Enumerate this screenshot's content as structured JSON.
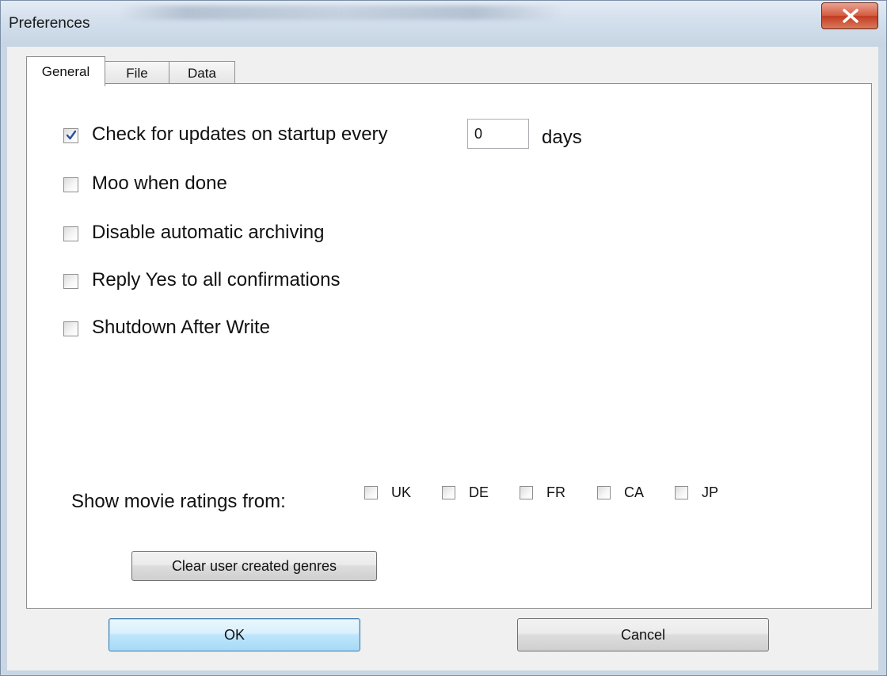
{
  "window": {
    "title": "Preferences",
    "close_icon": "close-icon"
  },
  "tabs": [
    {
      "label": "General",
      "active": true
    },
    {
      "label": "File",
      "active": false
    },
    {
      "label": "Data",
      "active": false
    }
  ],
  "general": {
    "options": [
      {
        "label": "Check for updates on startup every",
        "checked": true
      },
      {
        "label": "Moo when done",
        "checked": false
      },
      {
        "label": "Disable automatic archiving",
        "checked": false
      },
      {
        "label": "Reply Yes to all confirmations",
        "checked": false
      },
      {
        "label": "Shutdown After Write",
        "checked": false
      }
    ],
    "update_days_value": "0",
    "days_unit": "days",
    "ratings": {
      "label": "Show movie ratings from:",
      "countries": [
        {
          "code": "UK",
          "checked": false
        },
        {
          "code": "DE",
          "checked": false
        },
        {
          "code": "FR",
          "checked": false
        },
        {
          "code": "CA",
          "checked": false
        },
        {
          "code": "JP",
          "checked": false
        }
      ]
    },
    "clear_genres_label": "Clear user created genres"
  },
  "footer": {
    "ok_label": "OK",
    "cancel_label": "Cancel"
  },
  "colors": {
    "accent": "#3c7fb1",
    "close": "#c23b22",
    "check": "#2a4f9e"
  }
}
